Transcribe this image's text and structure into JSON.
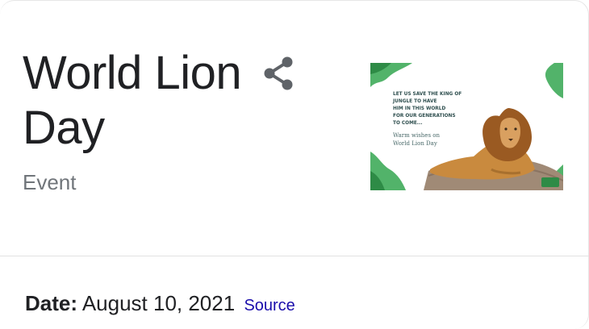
{
  "header": {
    "title_line1": "World Lion",
    "title_line2": "Day",
    "subtitle": "Event",
    "share_icon": "share-icon"
  },
  "image": {
    "headline_lines": [
      "LET US SAVE THE KING OF",
      "JUNGLE TO HAVE",
      "HIM IN THIS WORLD",
      "FOR OUR GENERATIONS",
      "TO COME..."
    ],
    "wishes_lines": [
      "Warm wishes on",
      "World Lion Day"
    ],
    "accent_color": "#4caf50"
  },
  "facts": {
    "date_label": "Date:",
    "date_value": "August 10, 2021",
    "source_label": "Source"
  },
  "colors": {
    "title": "#202124",
    "subtitle": "#70757a",
    "link": "#1a0dab"
  }
}
